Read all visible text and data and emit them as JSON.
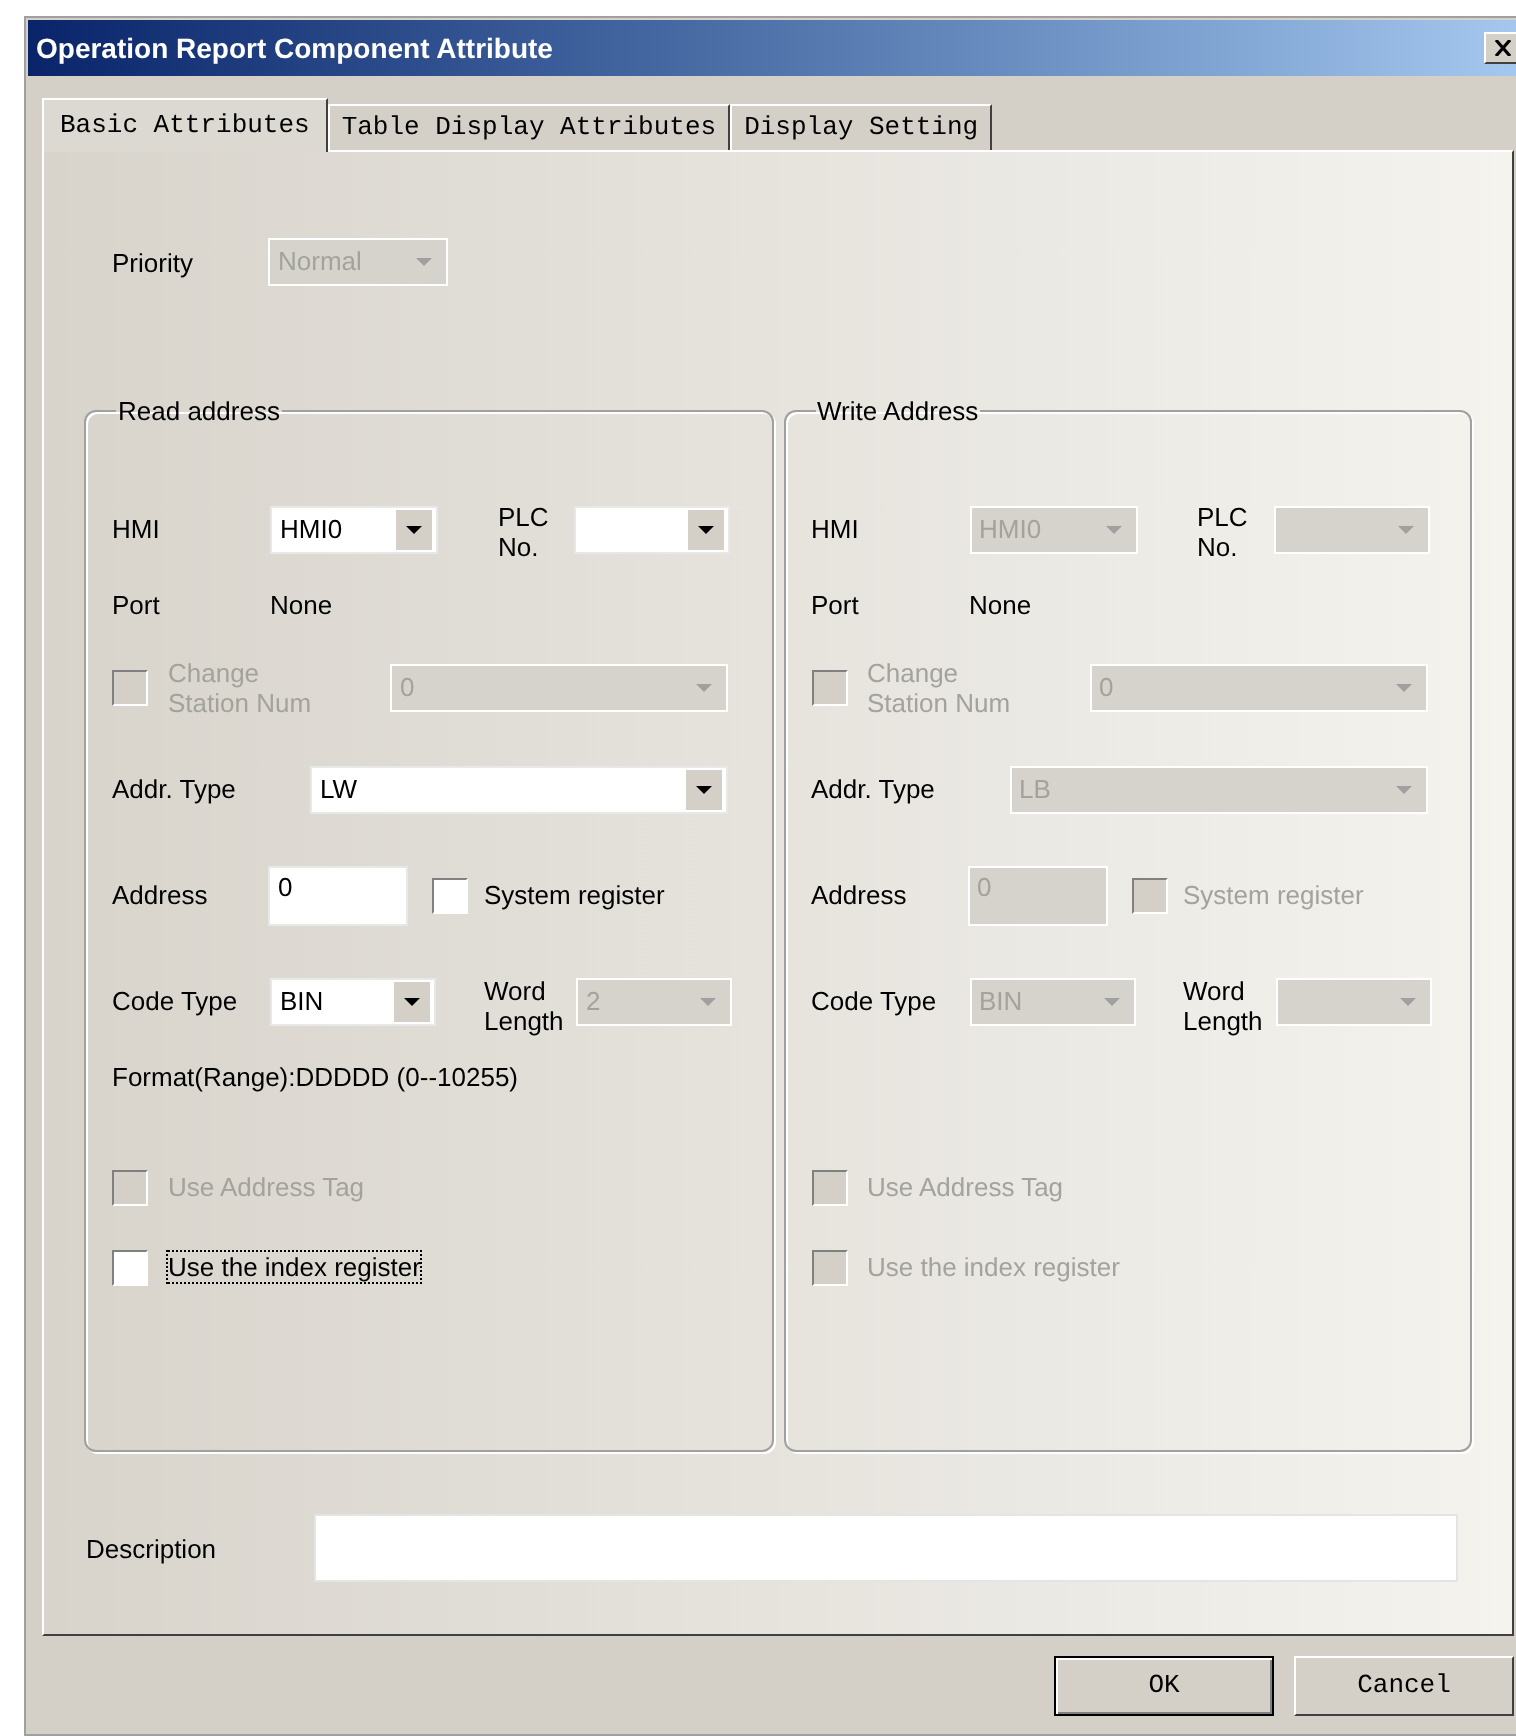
{
  "window": {
    "title": "Operation Report Component Attribute"
  },
  "tabs": [
    {
      "label": "Basic Attributes",
      "selected": true
    },
    {
      "label": "Table Display Attributes",
      "selected": false
    },
    {
      "label": "Display Setting",
      "selected": false
    }
  ],
  "priority": {
    "label": "Priority",
    "value": "Normal",
    "disabled": true
  },
  "groups": [
    {
      "title": "Read address",
      "hmi": {
        "label": "HMI",
        "value": "HMI0",
        "disabled": false
      },
      "plc_no": {
        "label": "PLC No.",
        "disabled": false
      },
      "port": {
        "label": "Port",
        "value": "None"
      },
      "change_station": {
        "label": "Change Station Num",
        "checked": false,
        "disabled": true
      },
      "station_num": {
        "value": "0",
        "disabled": true
      },
      "addr_type": {
        "label": "Addr. Type",
        "value": "LW",
        "disabled": false
      },
      "address": {
        "label": "Address",
        "value": "0",
        "disabled": false
      },
      "system_register": {
        "label": "System register",
        "checked": false,
        "disabled": false
      },
      "code_type": {
        "label": "Code Type",
        "value": "BIN",
        "disabled": false
      },
      "word_length": {
        "label": "Word Length",
        "value": "2",
        "disabled": true
      },
      "format": "Format(Range):DDDDD (0--10255)",
      "use_address_tag": {
        "label": "Use Address Tag",
        "checked": false,
        "disabled": true
      },
      "index_register": {
        "label": "Use the index register",
        "checked": false,
        "disabled": false,
        "focused": true
      }
    },
    {
      "title": "Write Address",
      "hmi": {
        "label": "HMI",
        "value": "HMI0",
        "disabled": true
      },
      "plc_no": {
        "label": "PLC No.",
        "disabled": true
      },
      "port": {
        "label": "Port",
        "value": "None"
      },
      "change_station": {
        "label": "Change Station Num",
        "checked": false,
        "disabled": true
      },
      "station_num": {
        "value": "0",
        "disabled": true
      },
      "addr_type": {
        "label": "Addr. Type",
        "value": "LB",
        "disabled": true
      },
      "address": {
        "label": "Address",
        "value": "0",
        "disabled": true
      },
      "system_register": {
        "label": "System register",
        "checked": false,
        "disabled": true
      },
      "code_type": {
        "label": "Code Type",
        "value": "BIN",
        "disabled": true
      },
      "word_length": {
        "label": "Word Length",
        "disabled": true
      },
      "use_address_tag": {
        "label": "Use Address Tag",
        "checked": false,
        "disabled": true
      },
      "index_register": {
        "label": "Use the index register",
        "checked": false,
        "disabled": true,
        "focused": false
      }
    }
  ],
  "description": {
    "label": "Description"
  },
  "buttons": [
    {
      "label": "OK",
      "default": true
    },
    {
      "label": "Cancel",
      "default": false
    }
  ]
}
